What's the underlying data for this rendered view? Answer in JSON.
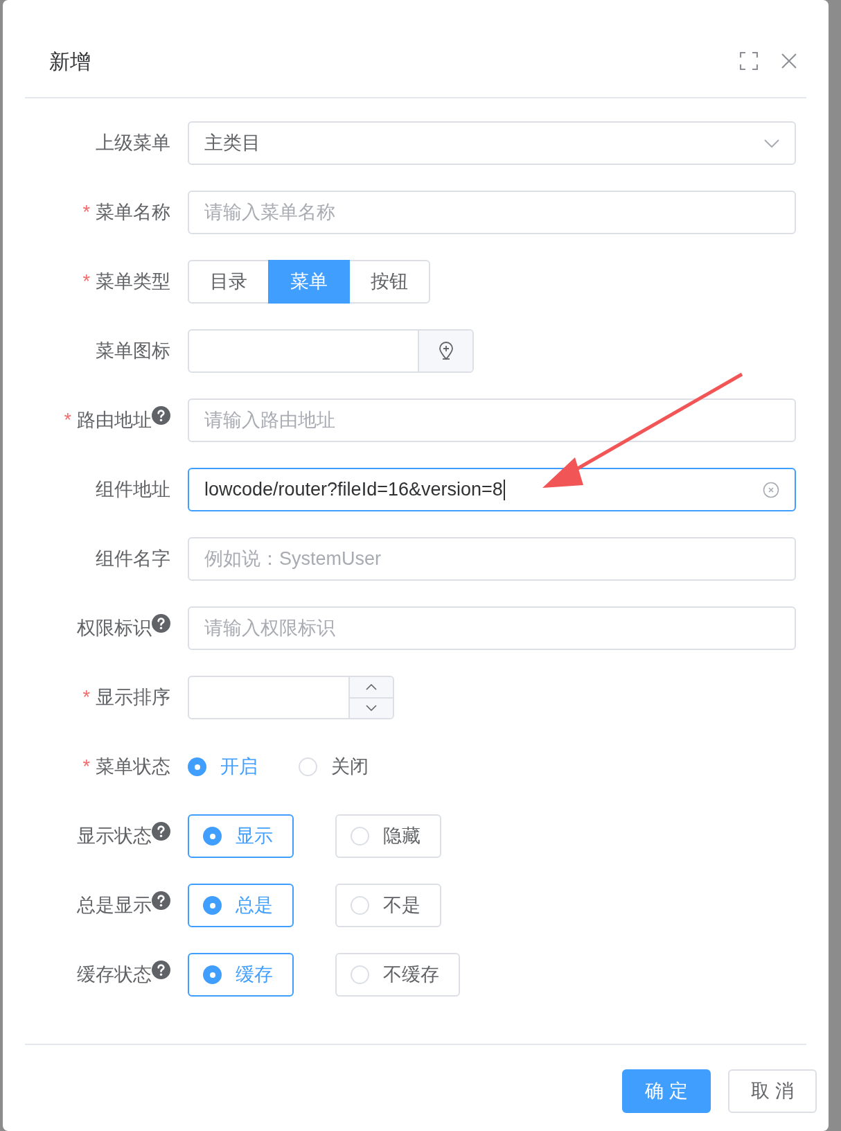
{
  "dialog": {
    "title": "新增"
  },
  "fields": [
    {
      "kind": "select",
      "label": "上级菜单",
      "help": false,
      "value": "主类目"
    },
    {
      "kind": "input",
      "label": "菜单名称",
      "required_mark": "*",
      "help": false,
      "placeholder": "请输入菜单名称"
    },
    {
      "kind": "segmented",
      "label": "菜单类型",
      "required_mark": "*",
      "help": false,
      "options": [
        {
          "label": "目录",
          "selected": false
        },
        {
          "label": "菜单",
          "selected": true
        },
        {
          "label": "按钮",
          "selected": false
        }
      ]
    },
    {
      "kind": "icon-input",
      "label": "菜单图标",
      "help": false
    },
    {
      "kind": "input",
      "label": "路由地址",
      "required_mark": "*",
      "help": true,
      "placeholder": "请输入路由地址"
    },
    {
      "kind": "input",
      "label": "组件地址",
      "help": false,
      "value": "lowcode/router?fileId=16&version=8",
      "focused": true
    },
    {
      "kind": "input",
      "label": "组件名字",
      "help": false,
      "placeholder": "例如说：SystemUser"
    },
    {
      "kind": "input",
      "label": "权限标识",
      "help": true,
      "placeholder": "请输入权限标识"
    },
    {
      "kind": "number",
      "label": "显示排序",
      "required_mark": "*",
      "help": false
    },
    {
      "kind": "radio",
      "label": "菜单状态",
      "required_mark": "*",
      "help": false,
      "options": [
        {
          "label": "开启",
          "selected": true
        },
        {
          "label": "关闭",
          "selected": false
        }
      ]
    },
    {
      "kind": "radio-bordered",
      "label": "显示状态",
      "help": true,
      "options": [
        {
          "label": "显示",
          "selected": true
        },
        {
          "label": "隐藏",
          "selected": false
        }
      ]
    },
    {
      "kind": "radio-bordered",
      "label": "总是显示",
      "help": true,
      "options": [
        {
          "label": "总是",
          "selected": true
        },
        {
          "label": "不是",
          "selected": false
        }
      ]
    },
    {
      "kind": "radio-bordered",
      "label": "缓存状态",
      "help": true,
      "options": [
        {
          "label": "缓存",
          "selected": true
        },
        {
          "label": "不缓存",
          "selected": false
        }
      ]
    }
  ],
  "buttons": [
    {
      "label": "确 定",
      "kind": "primary"
    },
    {
      "label": "取 消",
      "kind": "default"
    }
  ]
}
